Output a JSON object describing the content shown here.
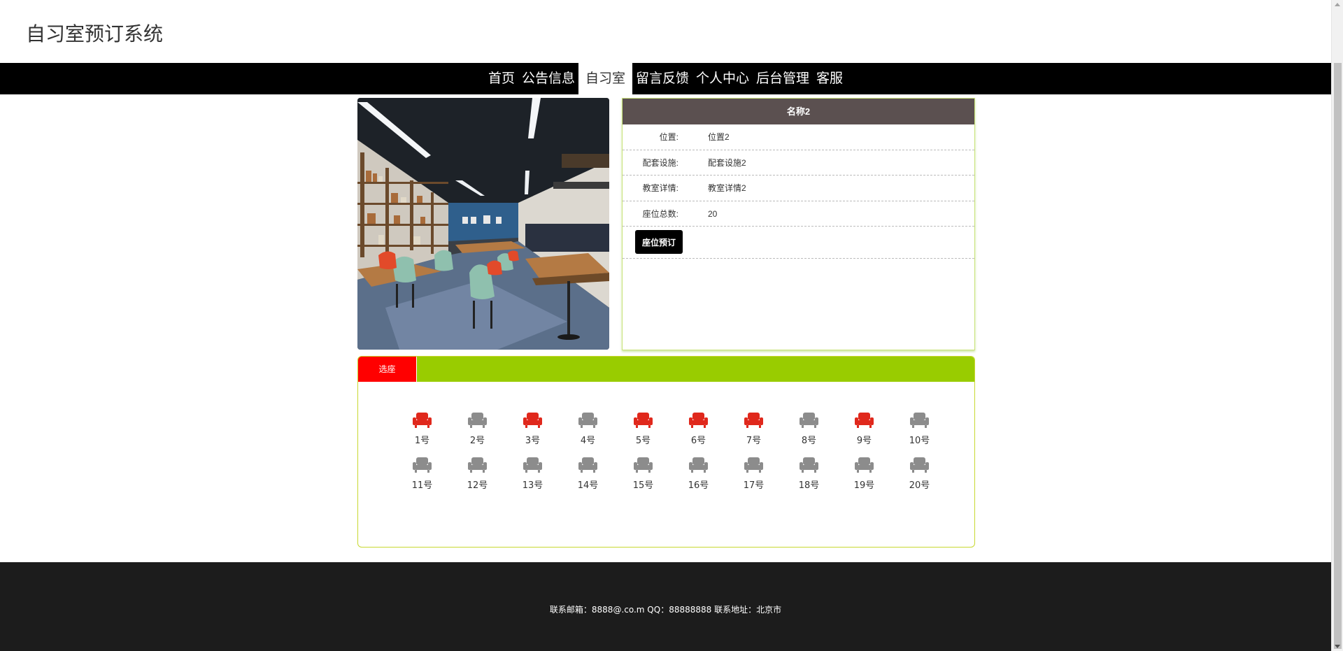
{
  "site": {
    "title": "自习室预订系统"
  },
  "nav": {
    "items": [
      {
        "label": "首页"
      },
      {
        "label": "公告信息"
      },
      {
        "label": "自习室",
        "active": true
      },
      {
        "label": "留言反馈"
      },
      {
        "label": "个人中心"
      },
      {
        "label": "后台管理"
      },
      {
        "label": "客服"
      }
    ]
  },
  "room": {
    "name": "名称2",
    "fields": [
      {
        "label": "位置:",
        "value": "位置2"
      },
      {
        "label": "配套设施:",
        "value": "配套设施2"
      },
      {
        "label": "教室详情:",
        "value": "教室详情2"
      },
      {
        "label": "座位总数:",
        "value": "20"
      }
    ],
    "book_button": "座位预订"
  },
  "seats": {
    "tab_label": "选座",
    "colors": {
      "booked": "#e0281c",
      "available": "#8c8c8c"
    },
    "icon": "armchair-icon",
    "items": [
      {
        "label": "1号",
        "booked": true
      },
      {
        "label": "2号",
        "booked": false
      },
      {
        "label": "3号",
        "booked": true
      },
      {
        "label": "4号",
        "booked": false
      },
      {
        "label": "5号",
        "booked": true
      },
      {
        "label": "6号",
        "booked": true
      },
      {
        "label": "7号",
        "booked": true
      },
      {
        "label": "8号",
        "booked": false
      },
      {
        "label": "9号",
        "booked": true
      },
      {
        "label": "10号",
        "booked": false
      },
      {
        "label": "11号",
        "booked": false
      },
      {
        "label": "12号",
        "booked": false
      },
      {
        "label": "13号",
        "booked": false
      },
      {
        "label": "14号",
        "booked": false
      },
      {
        "label": "15号",
        "booked": false
      },
      {
        "label": "16号",
        "booked": false
      },
      {
        "label": "17号",
        "booked": false
      },
      {
        "label": "18号",
        "booked": false
      },
      {
        "label": "19号",
        "booked": false
      },
      {
        "label": "20号",
        "booked": false
      }
    ]
  },
  "footer": {
    "text": "联系邮箱：8888@.co.m QQ：88888888 联系地址：北京市"
  }
}
